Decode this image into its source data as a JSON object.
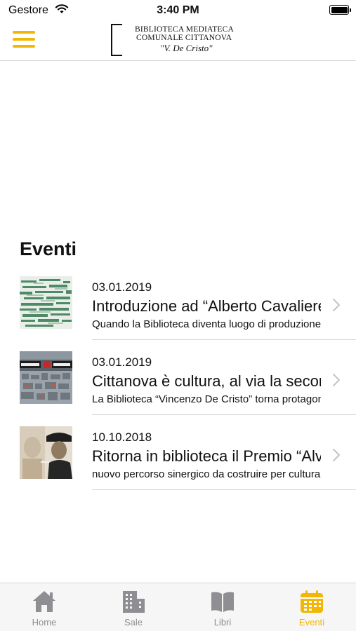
{
  "status_bar": {
    "carrier": "Gestore",
    "time": "3:40 PM"
  },
  "header": {
    "logo_line1": "BIBLIOTECA MEDIATECA",
    "logo_line2": "COMUNALE CITTANOVA",
    "logo_line3": "\"V. De Cristo\"",
    "menu_icon": "hamburger-icon"
  },
  "colors": {
    "accent": "#f2b705",
    "inactive": "#8e8e93",
    "separator": "#d4d4d4"
  },
  "events": {
    "title": "Eventi",
    "items": [
      {
        "date": "03.01.2019",
        "title": "Introduzione ad “Alberto Cavaliere",
        "desc": "Quando la Biblioteca diventa luogo di produzione"
      },
      {
        "date": "03.01.2019",
        "title": "Cittanova è cultura, al via la seconda",
        "desc": "La Biblioteca “Vincenzo De Cristo” torna protagonista"
      },
      {
        "date": "10.10.2018",
        "title": "Ritorna in biblioteca il Premio “Alvaro",
        "desc": "nuovo percorso sinergico da costruire per cultura"
      }
    ]
  },
  "tabs": [
    {
      "label": "Home",
      "icon": "home-icon"
    },
    {
      "label": "Sale",
      "icon": "building-icon"
    },
    {
      "label": "Libri",
      "icon": "book-icon"
    },
    {
      "label": "Eventi",
      "icon": "calendar-icon",
      "active": true
    }
  ]
}
